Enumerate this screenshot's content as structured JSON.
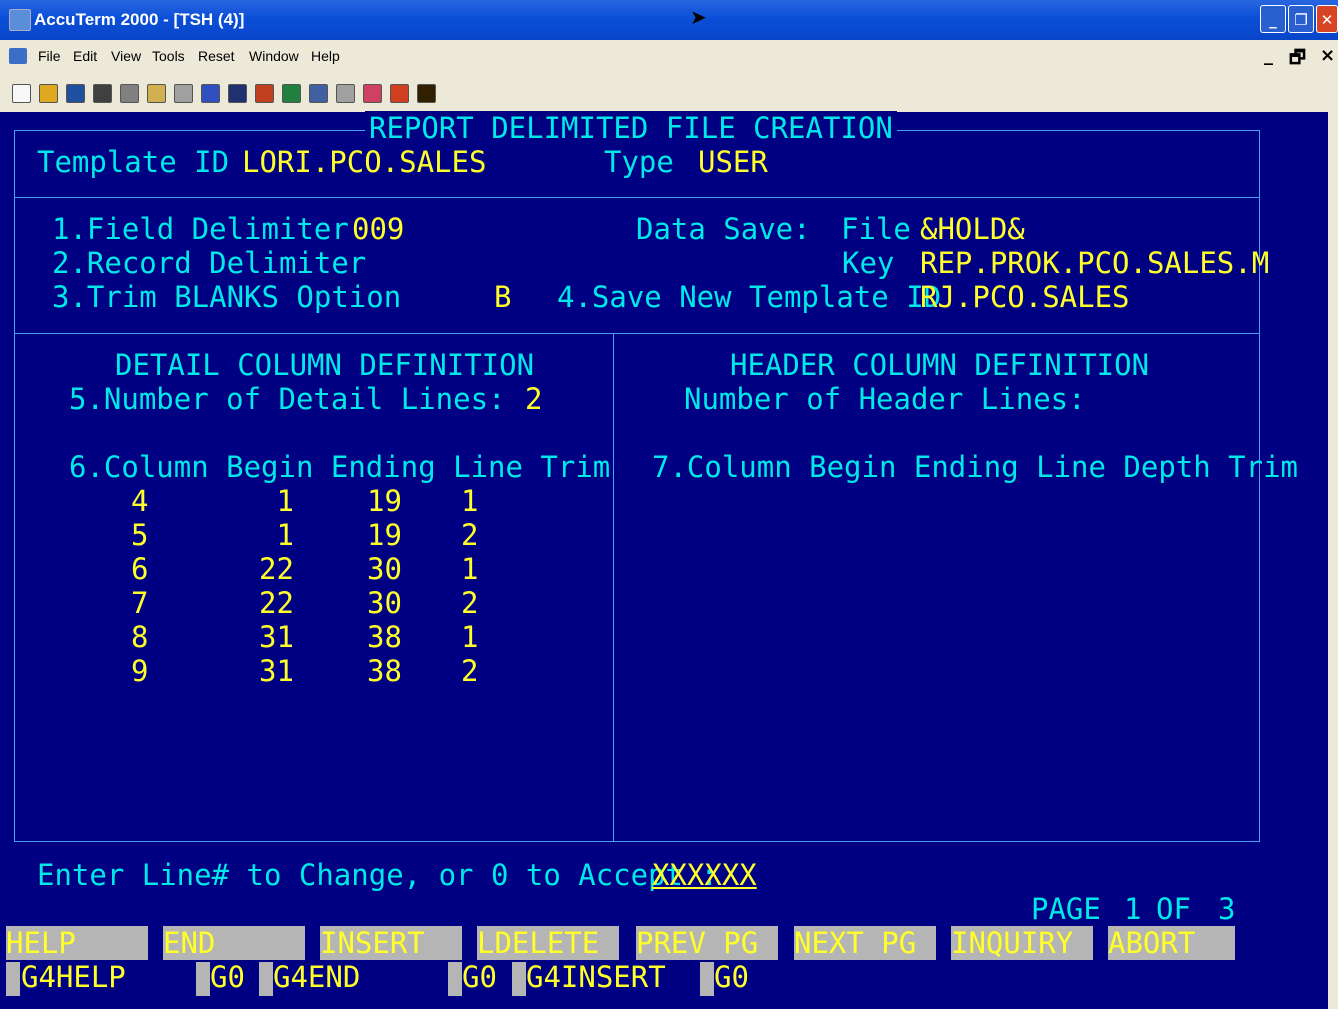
{
  "window": {
    "title": "AccuTerm 2000 - [TSH (4)]"
  },
  "titlebar_buttons": [
    "minimize-icon",
    "restore-icon",
    "close-icon"
  ],
  "menu": {
    "items": [
      "File",
      "Edit",
      "View",
      "Tools",
      "Reset",
      "Window",
      "Help"
    ],
    "mdi_min": "_",
    "mdi_restore": "🗗",
    "mdi_close": "×"
  },
  "toolbar": {
    "icons": [
      "new-icon",
      "open-icon",
      "save-icon",
      "print-icon",
      "cut-icon",
      "copy-icon",
      "paste-icon",
      "edit-icon",
      "capture-icon",
      "record-icon",
      "transfer-icon",
      "terminal-icon",
      "disconnect-icon",
      "settings-icon",
      "alert-icon",
      "help-icon"
    ],
    "colors": [
      "#f8f8f8",
      "#e0a820",
      "#2050a0",
      "#404040",
      "#808080",
      "#d0b050",
      "#a0a0a0",
      "#3050c0",
      "#203070",
      "#c04020",
      "#208040",
      "#4060a0",
      "#a0a0a0",
      "#d04060",
      "#d04020",
      "#302000"
    ]
  },
  "screen": {
    "title": "REPORT DELIMITED FILE CREATION",
    "template_label": "Template ID",
    "template_value": "LORI.PCO.SALES",
    "type_label": "Type",
    "type_value": "USER",
    "field_delim_label": "1.Field Delimiter",
    "field_delim_value": "009",
    "data_save_label": "Data Save:",
    "file_label": "File",
    "file_value": "&HOLD&",
    "record_delim_label": "2.Record Delimiter",
    "key_label": "Key",
    "key_value": "REP.PROK.PCO.SALES.M",
    "trim_label": "3.Trim BLANKS Option",
    "trim_value": "B",
    "save_new_label": "4.Save New Template ID",
    "save_new_value": "RJ.PCO.SALES",
    "detail_title": "DETAIL COLUMN DEFINITION",
    "detail_lines_label": "5.Number of Detail Lines:",
    "detail_lines_value": "2",
    "detail_headers": "6.Column Begin Ending Line Trim",
    "detail_rows": [
      {
        "column": "4",
        "begin": "1",
        "ending": "19",
        "line": "1"
      },
      {
        "column": "5",
        "begin": "1",
        "ending": "19",
        "line": "2"
      },
      {
        "column": "6",
        "begin": "22",
        "ending": "30",
        "line": "1"
      },
      {
        "column": "7",
        "begin": "22",
        "ending": "30",
        "line": "2"
      },
      {
        "column": "8",
        "begin": "31",
        "ending": "38",
        "line": "1"
      },
      {
        "column": "9",
        "begin": "31",
        "ending": "38",
        "line": "2"
      }
    ],
    "header_title": "HEADER COLUMN DEFINITION",
    "header_lines_label": "Number of Header Lines:",
    "header_headers": "7.Column Begin Ending Line Depth Trim",
    "prompt_label": "Enter Line# to Change, or 0 to Accept :",
    "prompt_value": "XXXXXX",
    "page_label": "PAGE",
    "page_current": "1",
    "page_of": "OF",
    "page_total": "3"
  },
  "function_keys": [
    "HELP",
    "END",
    "INSERT",
    "LDELETE",
    "PREV PG",
    "NEXT PG",
    "INQUIRY",
    "ABORT"
  ],
  "go_keys": [
    {
      "name": "G4HELP",
      "go": "G0"
    },
    {
      "name": "G4END",
      "go": "G0"
    },
    {
      "name": "G4INSERT",
      "go": "G0"
    }
  ]
}
